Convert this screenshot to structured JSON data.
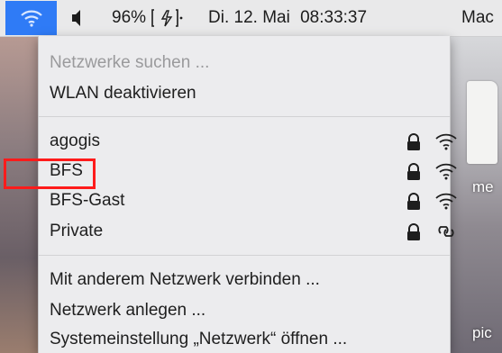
{
  "menubar": {
    "wifi_icon": "wifi-icon",
    "volume_icon": "speaker-icon",
    "battery_percent": "96%",
    "battery_icon": "battery-charging-icon",
    "date": "Di. 12. Mai",
    "time": "08:33:37",
    "user": "Mac"
  },
  "menu": {
    "search_label": "Netzwerke suchen ...",
    "disable_label": "WLAN deaktivieren",
    "networks": [
      {
        "name": "agogis",
        "secured": true,
        "signal_icon": "wifi-signal-icon"
      },
      {
        "name": "BFS",
        "secured": true,
        "signal_icon": "wifi-signal-icon"
      },
      {
        "name": "BFS-Gast",
        "secured": true,
        "signal_icon": "wifi-signal-icon"
      },
      {
        "name": "Private",
        "secured": true,
        "signal_icon": "personal-hotspot-icon"
      }
    ],
    "join_other_label": "Mit anderem Netzwerk verbinden ...",
    "create_network_label": "Netzwerk anlegen ...",
    "preferences_label": "Systemeinstellung „Netzwerk“ öffnen ..."
  },
  "desktop": {
    "fragment_top": "me",
    "fragment_bottom": "pic"
  },
  "annotation": {
    "highlighted_network": "BFS",
    "color": "#ff1b1b"
  },
  "colors": {
    "accent": "#2f7bf6",
    "menu_bg": "#ececee",
    "disabled_text": "#9a9a9c"
  }
}
